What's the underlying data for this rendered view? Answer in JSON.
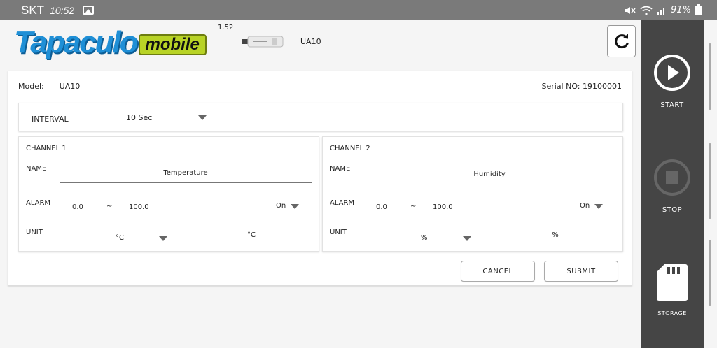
{
  "status_bar": {
    "carrier": "SKT",
    "time": "10:52",
    "battery": "91%"
  },
  "header": {
    "logo_main": "Tapaculo",
    "logo_badge": "mobile",
    "version": "1.52",
    "device_model": "UA10"
  },
  "sidebar": {
    "start_label": "START",
    "stop_label": "STOP",
    "storage_label": "STORAGE"
  },
  "device_info": {
    "model_label": "Model:",
    "model_value": "UA10",
    "serial_text": "Serial NO: 19100001"
  },
  "interval": {
    "label": "INTERVAL",
    "value": "10 Sec"
  },
  "channels": [
    {
      "title": "CHANNEL 1",
      "name_label": "NAME",
      "name_value": "Temperature",
      "alarm_label": "ALARM",
      "alarm_min": "0.0",
      "alarm_sep": "~",
      "alarm_max": "100.0",
      "alarm_state": "On",
      "unit_label": "UNIT",
      "unit_select": "°C",
      "unit_value": "°C"
    },
    {
      "title": "CHANNEL 2",
      "name_label": "NAME",
      "name_value": "Humidity",
      "alarm_label": "ALARM",
      "alarm_min": "0.0",
      "alarm_sep": "~",
      "alarm_max": "100.0",
      "alarm_state": "On",
      "unit_label": "UNIT",
      "unit_select": "%",
      "unit_value": "%"
    }
  ],
  "actions": {
    "cancel_label": "CANCEL",
    "submit_label": "SUBMIT"
  },
  "colors": {
    "logo_blue": "#1f8fd6",
    "logo_badge": "#b8d326",
    "sidebar": "#454545",
    "status_bar": "#7a7a7a"
  }
}
